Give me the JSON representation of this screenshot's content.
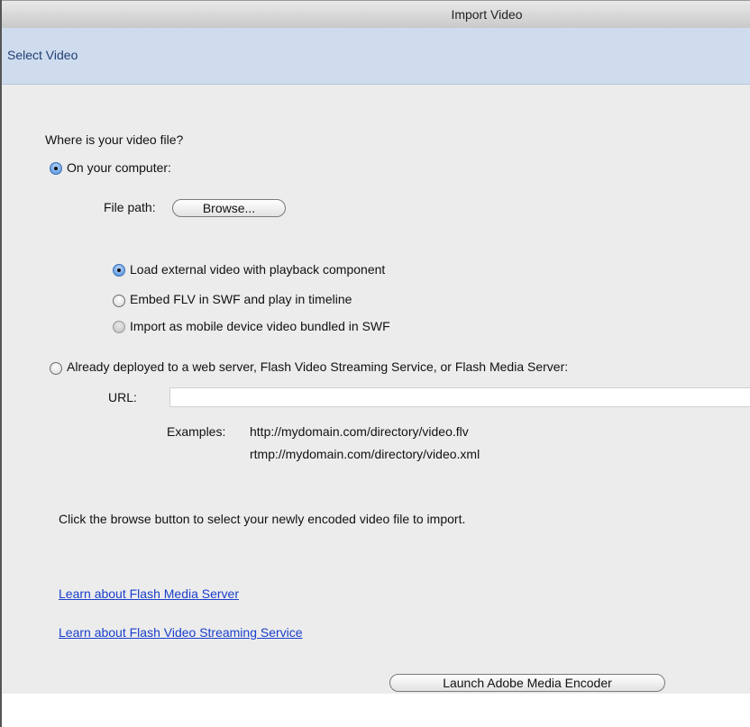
{
  "window": {
    "title": "Import Video"
  },
  "header": {
    "title": "Select Video"
  },
  "form": {
    "question": "Where is your video file?",
    "source_options": [
      {
        "label": "On your computer:",
        "selected": true
      },
      {
        "label": "Already deployed to a web server, Flash Video Streaming Service, or Flash Media Server:",
        "selected": false
      }
    ],
    "file_path_label": "File path:",
    "browse_label": "Browse...",
    "import_options": [
      {
        "label": "Load external video with playback component",
        "selected": true,
        "enabled": true
      },
      {
        "label": "Embed FLV in SWF and play in timeline",
        "selected": false,
        "enabled": true
      },
      {
        "label": "Import as mobile device video bundled in SWF",
        "selected": false,
        "enabled": false
      }
    ],
    "url_label": "URL:",
    "url_value": "",
    "examples_label": "Examples:",
    "examples": [
      "http://mydomain.com/directory/video.flv",
      "rtmp://mydomain.com/directory/video.xml"
    ],
    "hint": "Click the browse button to select your newly encoded video file to import."
  },
  "links": [
    "Learn about Flash Media Server",
    "Learn about Flash Video Streaming Service"
  ],
  "launch_button_label": "Launch Adobe Media Encoder",
  "colors": {
    "header_bg": "#cfdcee",
    "header_text": "#1f3f73",
    "content_bg": "#ececec",
    "link": "#1a3fcc"
  }
}
